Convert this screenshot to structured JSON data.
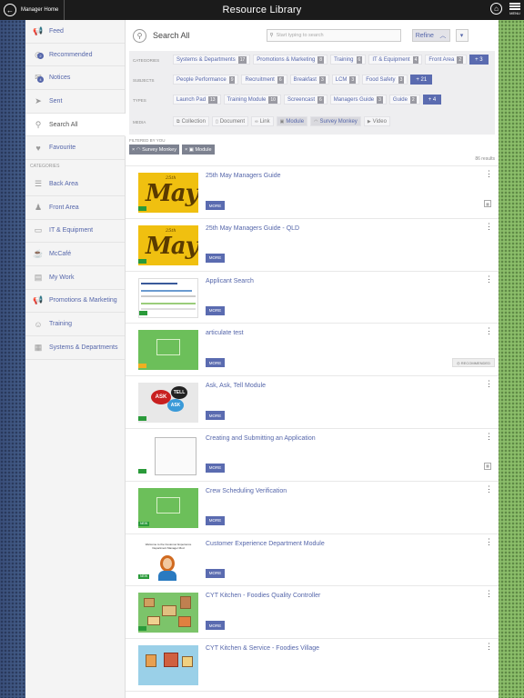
{
  "topbar": {
    "home_label": "Manager Home",
    "title": "Resource Library",
    "menu_label": "MENU"
  },
  "sidebar": {
    "items": [
      {
        "label": "Feed",
        "icon": "megaphone-icon"
      },
      {
        "label": "Recommended",
        "icon": "recommended-icon",
        "badge": "2"
      },
      {
        "label": "Notices",
        "icon": "mail-icon",
        "badge": "4"
      },
      {
        "label": "Sent",
        "icon": "send-icon"
      },
      {
        "label": "Search All",
        "icon": "search-icon"
      },
      {
        "label": "Favourite",
        "icon": "heart-icon"
      }
    ],
    "categories_header": "CATEGORIES",
    "categories": [
      {
        "label": "Back Area",
        "icon": "stack-icon"
      },
      {
        "label": "Front Area",
        "icon": "person-desk-icon"
      },
      {
        "label": "IT & Equipment",
        "icon": "monitor-icon"
      },
      {
        "label": "McCafé",
        "icon": "cup-icon"
      },
      {
        "label": "My Work",
        "icon": "id-card-icon"
      },
      {
        "label": "Promotions & Marketing",
        "icon": "megaphone-icon"
      },
      {
        "label": "Training",
        "icon": "trainer-icon"
      },
      {
        "label": "Systems & Departments",
        "icon": "cabinet-icon"
      }
    ]
  },
  "search": {
    "title": "Search All",
    "placeholder": "Start typing to search",
    "refine_label": "Refine"
  },
  "refine": {
    "categories_label": "CATEGORIES",
    "categories": [
      {
        "label": "Systems & Departments",
        "count": "17"
      },
      {
        "label": "Promotions & Marketing",
        "count": "8"
      },
      {
        "label": "Training",
        "count": "6"
      },
      {
        "label": "IT & Equipment",
        "count": "4"
      },
      {
        "label": "Front Area",
        "count": "2"
      }
    ],
    "categories_more": "+ 3",
    "subjects_label": "SUBJECTS",
    "subjects": [
      {
        "label": "People Performance",
        "count": "9"
      },
      {
        "label": "Recruitment",
        "count": "6"
      },
      {
        "label": "Breakfast",
        "count": "3"
      },
      {
        "label": "LCM",
        "count": "3"
      },
      {
        "label": "Food Safety",
        "count": "3"
      }
    ],
    "subjects_more": "+ 21",
    "types_label": "TYPES",
    "types": [
      {
        "label": "Launch Pad",
        "count": "13"
      },
      {
        "label": "Training Module",
        "count": "10"
      },
      {
        "label": "Screencast",
        "count": "6"
      },
      {
        "label": "Managers Guide",
        "count": "3"
      },
      {
        "label": "Guide",
        "count": "2"
      }
    ],
    "types_more": "+ 4",
    "media_label": "MEDIA",
    "media": [
      {
        "label": "Collection",
        "selected": false
      },
      {
        "label": "Document",
        "selected": false
      },
      {
        "label": "Link",
        "selected": false
      },
      {
        "label": "Module",
        "selected": true
      },
      {
        "label": "Survey Monkey",
        "selected": true
      },
      {
        "label": "Video",
        "selected": false
      }
    ]
  },
  "filtered": {
    "label": "FILTERED BY YOU",
    "chips": [
      "Survey Monkey",
      "Module"
    ]
  },
  "results_count": "86 results",
  "results": [
    {
      "title": "25th May Managers Guide",
      "thumb": "may",
      "tag": "",
      "extra": "calendar"
    },
    {
      "title": "25th May Managers Guide - QLD",
      "thumb": "may",
      "tag": "",
      "extra": ""
    },
    {
      "title": "Applicant Search",
      "thumb": "screen",
      "tag": "",
      "extra": ""
    },
    {
      "title": "articulate test",
      "thumb": "green",
      "tag": "",
      "extra": "recommended"
    },
    {
      "title": "Ask, Ask, Tell Module",
      "thumb": "ask",
      "tag": "",
      "extra": ""
    },
    {
      "title": "Creating and Submitting an Application",
      "thumb": "form",
      "tag": "",
      "extra": "calendar"
    },
    {
      "title": "Crew Scheduling Verification",
      "thumb": "green",
      "tag": "NEW",
      "extra": ""
    },
    {
      "title": "Customer Experience Department Module",
      "thumb": "cx",
      "tag": "NEW",
      "extra": ""
    },
    {
      "title": "CYT Kitchen - Foodies Quality Controller",
      "thumb": "city",
      "tag": "",
      "extra": ""
    },
    {
      "title": "CYT Kitchen & Service - Foodies Village",
      "thumb": "village",
      "tag": "",
      "extra": ""
    }
  ],
  "more_label": "MORE",
  "recommended_label": "RECOMMENDED",
  "thumb_text": {
    "may_small": "25th",
    "may_big": "May",
    "ask": "ASK",
    "tell": "TELL",
    "ask2": "ASK",
    "cx_header": "Welcome to the Customer Experience Department Manager Mod"
  }
}
